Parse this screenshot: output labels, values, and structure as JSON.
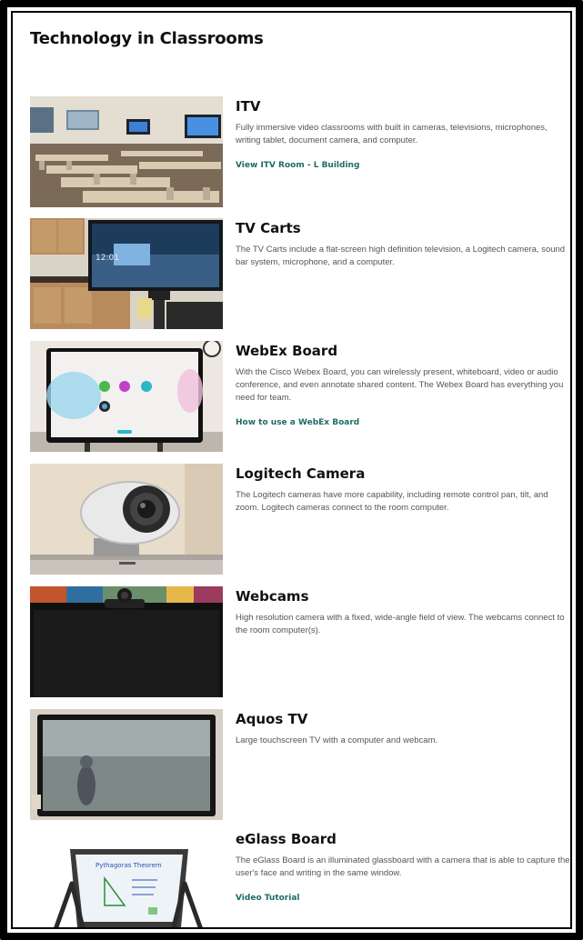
{
  "page": {
    "title": "Technology in Classrooms"
  },
  "items": [
    {
      "title": "ITV",
      "description": "Fully immersive video classrooms with built in cameras, televisions, microphones, writing tablet, document camera, and computer.",
      "link": "View ITV Room - L Building"
    },
    {
      "title": "TV Carts",
      "description": "The TV Carts include a flat-screen high definition television, a Logitech camera, sound bar system, microphone, and a computer.",
      "link": ""
    },
    {
      "title": "WebEx Board",
      "description": "With the Cisco Webex Board, you can wirelessly present, whiteboard, video or audio conference, and even annotate shared content. The Webex Board has everything you need for team.",
      "link": "How to use a WebEx Board"
    },
    {
      "title": "Logitech Camera",
      "description": "The Logitech cameras have more capability, including remote control pan, tilt, and zoom. Logitech cameras connect to the room computer.",
      "link": ""
    },
    {
      "title": "Webcams",
      "description": "High resolution camera with a fixed, wide-angle field of view. The webcams connect to the room computer(s).",
      "link": ""
    },
    {
      "title": "Aquos TV",
      "description": "Large touchscreen TV with a computer and webcam.",
      "link": ""
    },
    {
      "title": "eGlass Board",
      "description": "The eGlass Board is an illuminated glassboard with a camera that is able to capture the user's face and writing in the same window.",
      "link": "Video Tutorial"
    }
  ],
  "images": {
    "itv": {
      "screen_text": ""
    },
    "tvcart": {
      "screen_time": "12:01"
    },
    "eglass": {
      "board_heading": "Pythagoras Theorem"
    }
  }
}
